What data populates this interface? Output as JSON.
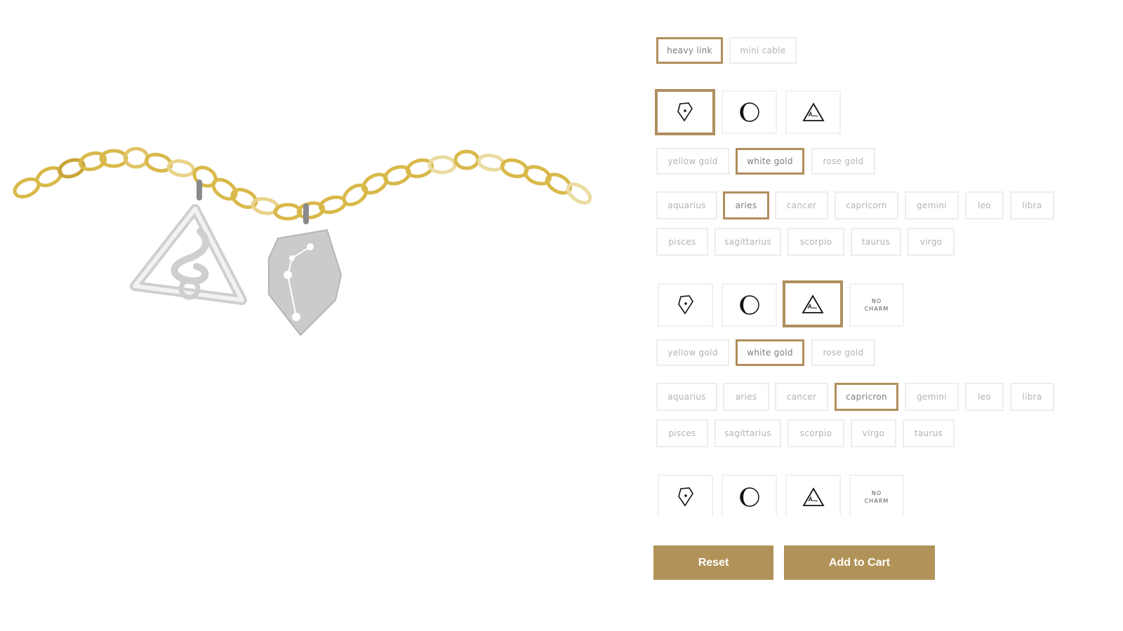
{
  "product_image": {
    "description": "Gold heavy link chain bracelet with two white gold charms: triangle (capricorn) and shield (aries constellation)",
    "colors": {
      "chain": "#d9b94a",
      "charm_metal": "#c9c9c9",
      "accent": "#b08e5e",
      "button": "#b19359"
    }
  },
  "chain_options": {
    "items": [
      {
        "label": "heavy link",
        "selected": true
      },
      {
        "label": "mini cable",
        "selected": false
      }
    ]
  },
  "charm1": {
    "shapes": [
      {
        "icon": "shield-icon",
        "selected": true
      },
      {
        "icon": "moon-icon",
        "selected": false
      },
      {
        "icon": "triangle-icon",
        "selected": false
      }
    ],
    "metals": [
      {
        "label": "yellow gold",
        "selected": false
      },
      {
        "label": "white gold",
        "selected": true
      },
      {
        "label": "rose gold",
        "selected": false
      }
    ],
    "signs": [
      {
        "label": "aquarius",
        "selected": false
      },
      {
        "label": "aries",
        "selected": true
      },
      {
        "label": "cancer",
        "selected": false
      },
      {
        "label": "capricorn",
        "selected": false
      },
      {
        "label": "gemini",
        "selected": false
      },
      {
        "label": "leo",
        "selected": false
      },
      {
        "label": "libra",
        "selected": false
      },
      {
        "label": "pisces",
        "selected": false
      },
      {
        "label": "sagittarius",
        "selected": false
      },
      {
        "label": "scorpio",
        "selected": false
      },
      {
        "label": "taurus",
        "selected": false
      },
      {
        "label": "virgo",
        "selected": false
      }
    ]
  },
  "charm2": {
    "shapes": [
      {
        "icon": "shield-icon",
        "selected": false
      },
      {
        "icon": "moon-icon",
        "selected": false
      },
      {
        "icon": "triangle-icon",
        "selected": true
      },
      {
        "icon": "no-charm",
        "label_line1": "NO",
        "label_line2": "CHARM",
        "selected": false
      }
    ],
    "metals": [
      {
        "label": "yellow gold",
        "selected": false
      },
      {
        "label": "white gold",
        "selected": true
      },
      {
        "label": "rose gold",
        "selected": false
      }
    ],
    "signs": [
      {
        "label": "aquarius",
        "selected": false
      },
      {
        "label": "aries",
        "selected": false
      },
      {
        "label": "cancer",
        "selected": false
      },
      {
        "label": "capricron",
        "selected": true
      },
      {
        "label": "gemini",
        "selected": false
      },
      {
        "label": "leo",
        "selected": false
      },
      {
        "label": "libra",
        "selected": false
      },
      {
        "label": "pisces",
        "selected": false
      },
      {
        "label": "sagittarius",
        "selected": false
      },
      {
        "label": "scorpio",
        "selected": false
      },
      {
        "label": "virgo",
        "selected": false
      },
      {
        "label": "taurus",
        "selected": false
      }
    ]
  },
  "charm3": {
    "shapes": [
      {
        "icon": "shield-icon",
        "selected": false
      },
      {
        "icon": "moon-icon",
        "selected": false
      },
      {
        "icon": "triangle-icon",
        "selected": false
      },
      {
        "icon": "no-charm",
        "label_line1": "NO",
        "label_line2": "CHARM",
        "selected": false
      }
    ]
  },
  "actions": {
    "reset_label": "Reset",
    "add_to_cart_label": "Add to Cart"
  }
}
